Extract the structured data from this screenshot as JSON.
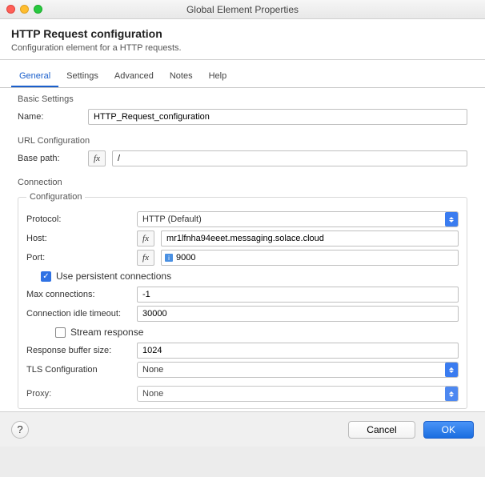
{
  "window": {
    "title": "Global Element Properties"
  },
  "header": {
    "title": "HTTP Request configuration",
    "subtitle": "Configuration element for a HTTP requests."
  },
  "tabs": [
    {
      "label": "General",
      "active": true
    },
    {
      "label": "Settings"
    },
    {
      "label": "Advanced"
    },
    {
      "label": "Notes"
    },
    {
      "label": "Help"
    }
  ],
  "basic": {
    "title": "Basic Settings",
    "name_label": "Name:",
    "name_value": "HTTP_Request_configuration"
  },
  "url": {
    "title": "URL Configuration",
    "base_path_label": "Base path:",
    "base_path_value": "/"
  },
  "connection": {
    "title": "Connection",
    "config_title": "Configuration",
    "protocol_label": "Protocol:",
    "protocol_value": "HTTP (Default)",
    "host_label": "Host:",
    "host_value": "mr1lfnha94eeet.messaging.solace.cloud",
    "port_label": "Port:",
    "port_value": "9000",
    "persistent_label": "Use persistent connections",
    "persistent_checked": true,
    "max_conn_label": "Max connections:",
    "max_conn_value": "-1",
    "idle_label": "Connection idle timeout:",
    "idle_value": "30000",
    "stream_label": "Stream response",
    "stream_checked": false,
    "buffer_label": "Response buffer size:",
    "buffer_value": "1024",
    "tls_label": "TLS Configuration",
    "tls_value": "None",
    "proxy_label": "Proxy:",
    "proxy_value": "None"
  },
  "footer": {
    "help": "?",
    "cancel": "Cancel",
    "ok": "OK"
  }
}
